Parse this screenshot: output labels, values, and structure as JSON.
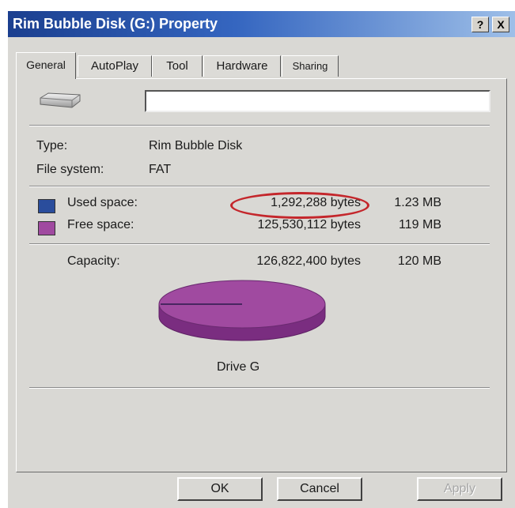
{
  "window": {
    "title": "Rim Bubble Disk (G:) Property",
    "help_button": "?",
    "close_button": "X"
  },
  "tabs": [
    {
      "label": "General",
      "active": true
    },
    {
      "label": "AutoPlay",
      "active": false
    },
    {
      "label": "Tool",
      "active": false
    },
    {
      "label": "Hardware",
      "active": false
    },
    {
      "label": "Sharing",
      "active": false
    }
  ],
  "general": {
    "drive_icon": "drive-icon",
    "volume_name_value": "",
    "type_label": "Type:",
    "type_value": "Rim Bubble Disk",
    "filesystem_label": "File system:",
    "filesystem_value": "FAT",
    "used": {
      "label": "Used space:",
      "bytes": "1,292,288 bytes",
      "size": "1.23 MB",
      "color": "#2a4d9c"
    },
    "free": {
      "label": "Free space:",
      "bytes": "125,530,112 bytes",
      "size": "119 MB",
      "color": "#a04aa0"
    },
    "capacity": {
      "label": "Capacity:",
      "bytes": "126,822,400 bytes",
      "size": "120 MB"
    },
    "drive_label": "Drive G",
    "annotation_color": "#c4262b"
  },
  "buttons": {
    "ok": "OK",
    "cancel": "Cancel",
    "apply": "Apply"
  }
}
